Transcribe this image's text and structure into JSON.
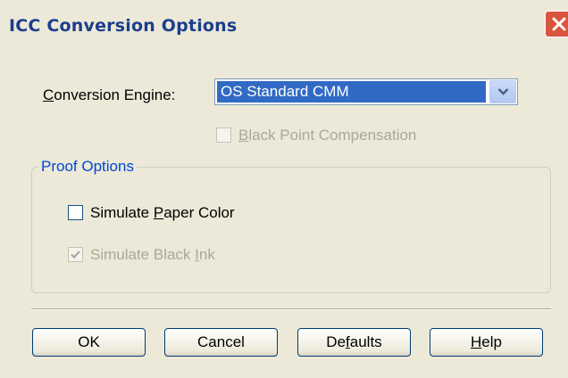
{
  "window": {
    "title": "ICC Conversion Options"
  },
  "conversion_engine": {
    "label_mnemonic": "C",
    "label_rest": "onversion Engine:",
    "selected_value": "OS Standard CMM"
  },
  "black_point": {
    "mnemonic": "B",
    "label_rest": "lack Point Compensation",
    "checked": false,
    "enabled": false
  },
  "proof_options": {
    "group_title": "Proof Options",
    "simulate_paper": {
      "label_before": "Simulate ",
      "mnemonic": "P",
      "label_after": "aper Color",
      "checked": false,
      "enabled": true
    },
    "simulate_ink": {
      "label_before": "Simulate Black ",
      "mnemonic": "I",
      "label_after": "nk",
      "checked": true,
      "enabled": false
    }
  },
  "buttons": {
    "ok": "OK",
    "cancel": "Cancel",
    "defaults_before": "De",
    "defaults_mnemonic": "f",
    "defaults_after": "aults",
    "help_mnemonic": "H",
    "help_rest": "elp"
  },
  "colors": {
    "title_text": "#1d3e8c",
    "selection_bg": "#316ac5",
    "close_button": "#d9553d",
    "group_title": "#0046d5",
    "disabled_text": "#aca899"
  }
}
